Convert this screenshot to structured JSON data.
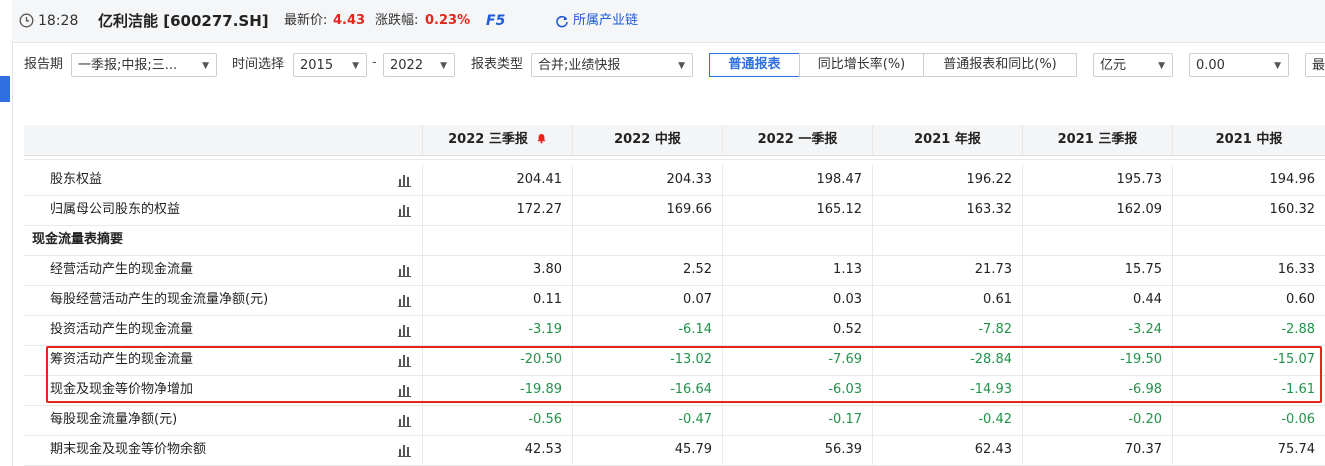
{
  "header": {
    "time": "18:28",
    "stock": "亿利洁能 [600277.SH]",
    "price_label": "最新价:",
    "price": "4.43",
    "change_label": "涨跌幅:",
    "change": "0.23%",
    "f5": "F5",
    "industry_chain": "所属产业链"
  },
  "filters": {
    "period_label": "报告期",
    "period_value": "一季报;中报;三...",
    "time_label": "时间选择",
    "year_from": "2015",
    "dash": "-",
    "year_to": "2022",
    "type_label": "报表类型",
    "type_value": "合并;业绩快报",
    "tabs": [
      "普通报表",
      "同比增长率(%)",
      "普通报表和同比(%)"
    ],
    "unit": "亿元",
    "decimals": "0.00",
    "last": "最"
  },
  "table": {
    "columns": [
      "2022 三季报",
      "2022 中报",
      "2022 一季报",
      "2021 年报",
      "2021 三季报",
      "2021 中报"
    ],
    "rows": [
      {
        "label": "股东权益",
        "values": [
          "204.41",
          "204.33",
          "198.47",
          "196.22",
          "195.73",
          "194.96"
        ]
      },
      {
        "label": "归属母公司股东的权益",
        "values": [
          "172.27",
          "169.66",
          "165.12",
          "163.32",
          "162.09",
          "160.32"
        ]
      },
      {
        "label": "现金流量表摘要",
        "section": true,
        "values": []
      },
      {
        "label": "经营活动产生的现金流量",
        "values": [
          "3.80",
          "2.52",
          "1.13",
          "21.73",
          "15.75",
          "16.33"
        ]
      },
      {
        "label": "每股经营活动产生的现金流量净额(元)",
        "values": [
          "0.11",
          "0.07",
          "0.03",
          "0.61",
          "0.44",
          "0.60"
        ]
      },
      {
        "label": "投资活动产生的现金流量",
        "values": [
          "-3.19",
          "-6.14",
          "0.52",
          "-7.82",
          "-3.24",
          "-2.88"
        ]
      },
      {
        "label": "筹资活动产生的现金流量",
        "values": [
          "-20.50",
          "-13.02",
          "-7.69",
          "-28.84",
          "-19.50",
          "-15.07"
        ]
      },
      {
        "label": "现金及现金等价物净增加",
        "values": [
          "-19.89",
          "-16.64",
          "-6.03",
          "-14.93",
          "-6.98",
          "-1.61"
        ]
      },
      {
        "label": "每股现金流量净额(元)",
        "values": [
          "-0.56",
          "-0.47",
          "-0.17",
          "-0.42",
          "-0.20",
          "-0.06"
        ]
      },
      {
        "label": "期末现金及现金等价物余额",
        "values": [
          "42.53",
          "45.79",
          "56.39",
          "62.43",
          "70.37",
          "75.74"
        ]
      }
    ]
  },
  "colors": {
    "accent": "#2f6fe0",
    "up": "#e0281e",
    "down": "#23924a",
    "highlight": "#e8231b"
  }
}
